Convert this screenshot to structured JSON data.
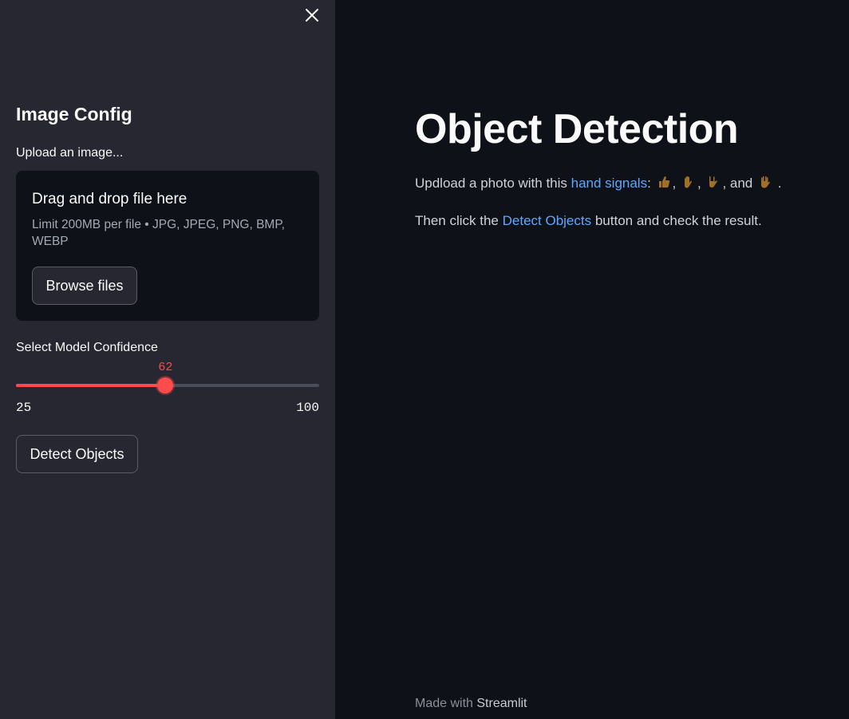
{
  "sidebar": {
    "title": "Image Config",
    "upload_label": "Upload an image...",
    "dropzone": {
      "title": "Drag and drop file here",
      "limit_text": "Limit 200MB per file • JPG, JPEG, PNG, BMP, WEBP",
      "browse_label": "Browse files"
    },
    "slider": {
      "label": "Select Model Confidence",
      "value": "62",
      "min": "25",
      "max": "100",
      "fraction": 0.493
    },
    "detect_label": "Detect Objects"
  },
  "main": {
    "title": "Object Detection",
    "para1": {
      "prefix": "Updload a photo with this ",
      "link": "hand signals",
      "colon": ": ",
      "sep1": ", ",
      "sep2": ", ",
      "sep3": ", and ",
      "end": "."
    },
    "para2": {
      "prefix": "Then click the ",
      "link": "Detect Objects",
      "suffix": " button and check the result."
    },
    "footer": {
      "prefix": "Made with ",
      "brand": "Streamlit"
    }
  },
  "icons": {
    "close": "close-icon",
    "thumbs_up": "thumbs-up-icon",
    "raised_hand": "raised-hand-icon",
    "rock_on": "rock-on-icon",
    "vulcan": "vulcan-salute-icon"
  },
  "colors": {
    "accent": "#ff4b4b",
    "sidebar_bg": "#262730",
    "main_bg": "#0e1117",
    "link": "#5fa7ff",
    "emoji_skin": "#a0702a"
  }
}
